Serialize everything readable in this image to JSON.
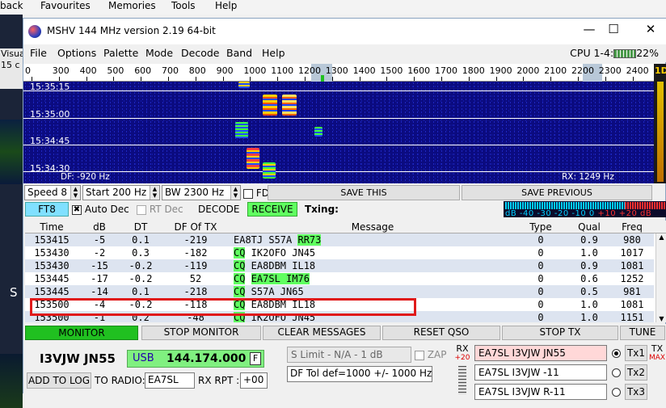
{
  "background": {
    "menu": [
      "back",
      "Favourites",
      "Memories",
      "Tools",
      "Help"
    ],
    "left_text": [
      "Visua",
      "15 c"
    ],
    "left_letter": "S"
  },
  "window": {
    "title": "MSHV 144 MHz version 2.19 64-bit",
    "controls": {
      "minimize": "—",
      "maximize": "☐",
      "close": "✕"
    }
  },
  "menu": [
    "File",
    "Options",
    "Palette",
    "Mode",
    "Decode",
    "Band",
    "Help"
  ],
  "cpu": {
    "label": "CPU 1-4:",
    "percent": "22%"
  },
  "ruler": {
    "ticks": [
      "0",
      "300",
      "400",
      "500",
      "600",
      "700",
      "800",
      "900",
      "1000",
      "1100",
      "1200",
      "1300",
      "1400",
      "1500",
      "1600",
      "1700",
      "1800",
      "1900",
      "2000",
      "2100",
      "2200",
      "2300",
      "2400"
    ],
    "side_label": "1D"
  },
  "waterfall": {
    "times": [
      "15:35:15",
      "15:35:00",
      "15:34:45",
      "15:34:30"
    ],
    "df_label": "DF: -920 Hz",
    "rx_label": "RX: 1249 Hz"
  },
  "controls": {
    "speed": "Speed 8",
    "start": "Start 200 Hz",
    "bw": "BW 2300 Hz",
    "fd": "FD",
    "save_this": "SAVE THIS",
    "save_previous": "SAVE PREVIOUS"
  },
  "mode_row": {
    "mode": "FT8",
    "auto_dec": "Auto Dec",
    "rt_dec": "RT Dec",
    "decode": "DECODE",
    "receive": "RECEIVE",
    "txing": "Txing:"
  },
  "meter": {
    "scale": "dB -40  -30  -20  -10  0",
    "scale_red": "+10 +20 dB"
  },
  "table": {
    "headers": [
      "Time",
      "dB",
      "DT",
      "DF Of TX",
      "Message",
      "Type",
      "Qual",
      "Freq"
    ],
    "rows": [
      {
        "time": "153415",
        "db": "-5",
        "dt": "0.1",
        "df": "-219",
        "m1": "EA8TJ S57A ",
        "m2": "RR73",
        "m3": "",
        "m4": "",
        "type": "0",
        "qual": "0.9",
        "freq": "980"
      },
      {
        "time": "153430",
        "db": "-2",
        "dt": "0.3",
        "df": "-182",
        "m1": "",
        "m2": "CQ",
        "m3": " IK2OFO JN45",
        "m4": "",
        "type": "0",
        "qual": "1.0",
        "freq": "1017"
      },
      {
        "time": "153430",
        "db": "-15",
        "dt": "-0.2",
        "df": "-119",
        "m1": "",
        "m2": "CQ",
        "m3": " EA8DBM IL18",
        "m4": "",
        "type": "0",
        "qual": "0.9",
        "freq": "1081"
      },
      {
        "time": "153445",
        "db": "-17",
        "dt": "-0.2",
        "df": "52",
        "m1": "",
        "m2": "CQ",
        "m3": " ",
        "m4": "EA7SL IM76",
        "type": "0",
        "qual": "0.6",
        "freq": "1252"
      },
      {
        "time": "153445",
        "db": "-14",
        "dt": "0.1",
        "df": "-218",
        "m1": "",
        "m2": "CQ",
        "m3": " S57A JN65",
        "m4": "",
        "type": "0",
        "qual": "0.5",
        "freq": "981"
      },
      {
        "time": "153500",
        "db": "-4",
        "dt": "-0.2",
        "df": "-118",
        "m1": "",
        "m2": "CQ",
        "m3": " EA8DBM IL18",
        "m4": "",
        "type": "0",
        "qual": "1.0",
        "freq": "1081"
      },
      {
        "time": "153500",
        "db": "-1",
        "dt": "0.2",
        "df": "-48",
        "m1": "",
        "m2": "CQ",
        "m3": " IK2OFO JN45",
        "m4": "",
        "type": "0",
        "qual": "1.0",
        "freq": "1151"
      }
    ]
  },
  "bottom": {
    "monitor": "MONITOR",
    "stop_monitor": "STOP MONITOR",
    "clear_messages": "CLEAR MESSAGES",
    "reset_qso": "RESET QSO",
    "stop_tx": "STOP TX",
    "tune": "TUNE",
    "my_call": "I3VJW JN55",
    "usb": "USB",
    "freq": "144.174.000",
    "f_btn": "F",
    "add_to_log": "ADD TO LOG",
    "to_radio_label": "TO RADIO:",
    "to_radio_value": "EA7SL",
    "rx_rpt_label": "RX RPT :",
    "rx_rpt_value": "+00",
    "s_limit": "S Limit - N/A - 1  dB",
    "zap": "ZAP",
    "df_tol": "DF Tol def=1000 +/-  1000  Hz",
    "rx_label": "RX",
    "rx_plus": "+20",
    "macros": [
      "EA7SL I3VJW JN55",
      "EA7SL I3VJW -11",
      "EA7SL I3VJW R-11"
    ],
    "tx_buttons": [
      "Tx1",
      "Tx2",
      "Tx3"
    ],
    "tx_label": "TX",
    "max_label": "MAX"
  }
}
